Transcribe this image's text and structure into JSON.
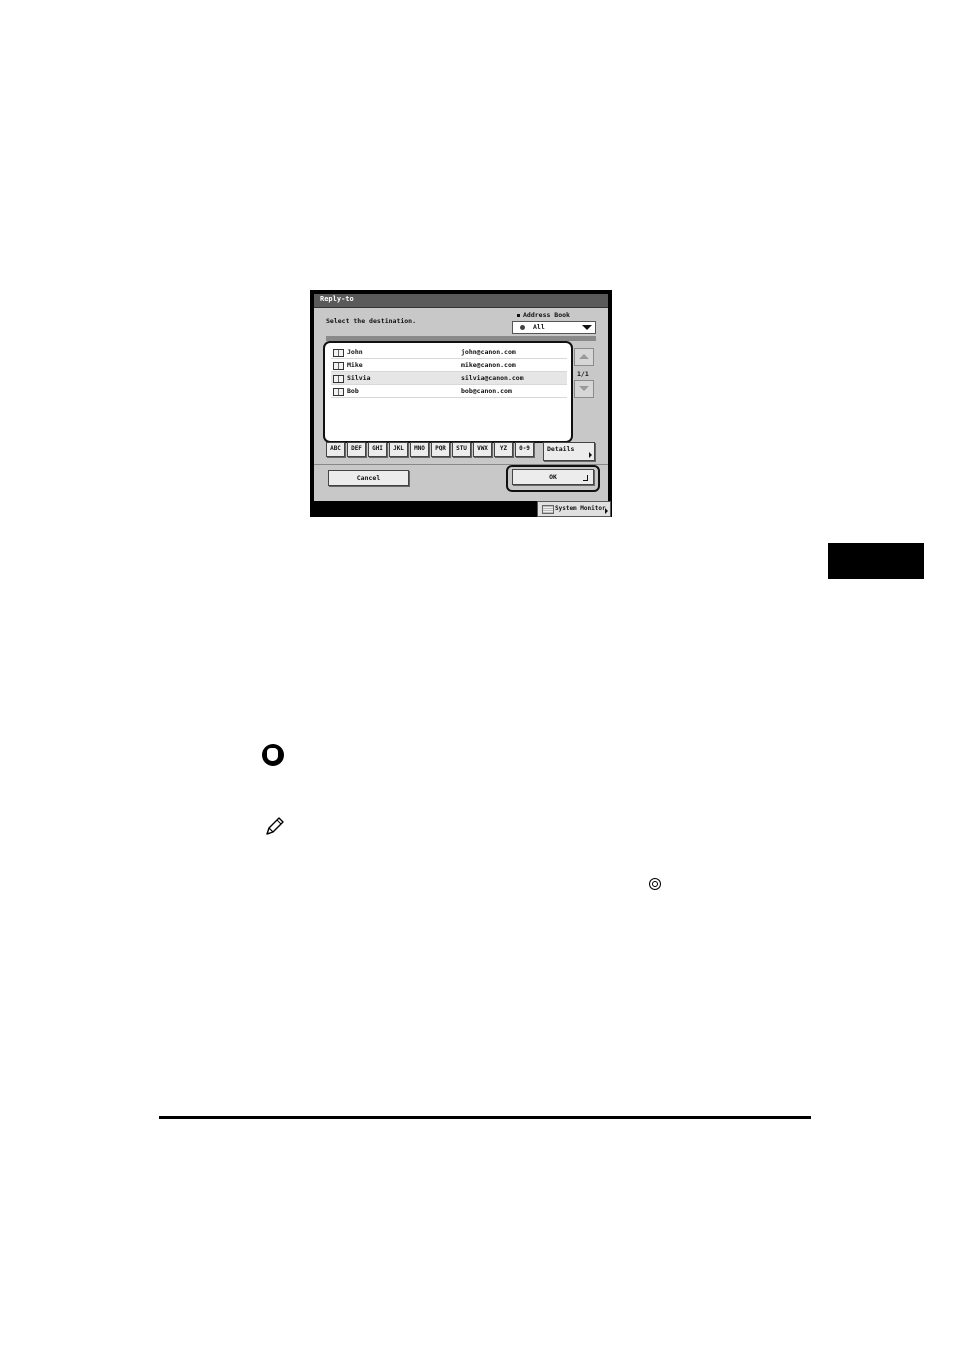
{
  "screen": {
    "title": "Reply-to",
    "prompt": "Select the destination.",
    "address_book": {
      "label": "Address Book",
      "selected": "All"
    },
    "entries": [
      {
        "name": "John",
        "address": "john@canon.com",
        "selected": false
      },
      {
        "name": "Mike",
        "address": "mike@canon.com",
        "selected": false
      },
      {
        "name": "Silvia",
        "address": "silvia@canon.com",
        "selected": true
      },
      {
        "name": "Bob",
        "address": "bob@canon.com",
        "selected": false
      }
    ],
    "page_indicator": "1/1",
    "alpha_keys": [
      "ABC",
      "DEF",
      "GHI",
      "JKL",
      "MNO",
      "PQR",
      "STU",
      "VWX",
      "YZ",
      "0-9"
    ],
    "details_label": "Details",
    "cancel_label": "Cancel",
    "ok_label": "OK",
    "system_monitor_label": "System Monitor"
  },
  "icons": {
    "caution": "caution-hand-icon",
    "note": "pencil-note-icon",
    "inline": "start-key-icon"
  },
  "colors": {
    "screen_bg": "#000000",
    "panel_bg": "#c8c8c8",
    "selected_row": "#e6e6e6"
  }
}
